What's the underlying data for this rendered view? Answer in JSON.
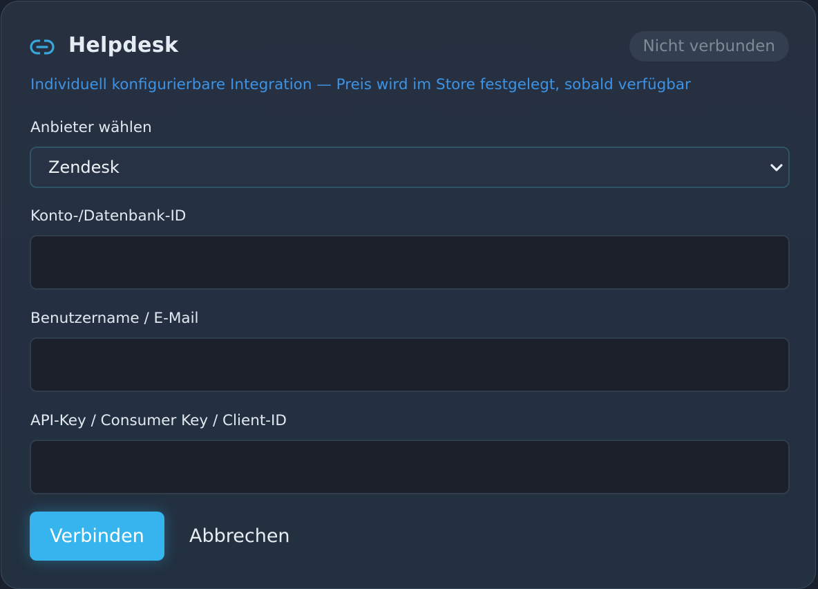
{
  "header": {
    "icon": "link-icon",
    "title": "Helpdesk",
    "status": "Nicht verbunden"
  },
  "subtitle": "Individuell konfigurierbare Integration — Preis wird im Store festgelegt, sobald verfügbar",
  "form": {
    "provider": {
      "label": "Anbieter wählen",
      "selected": "Zendesk"
    },
    "account_id": {
      "label": "Konto-/Datenbank-ID",
      "value": ""
    },
    "username": {
      "label": "Benutzername / E-Mail",
      "value": ""
    },
    "api_key": {
      "label": "API-Key / Consumer Key / Client-ID",
      "value": ""
    }
  },
  "actions": {
    "connect_label": "Verbinden",
    "cancel_label": "Abbrechen"
  },
  "colors": {
    "accent": "#36b4ee",
    "link": "#3d93e6",
    "card_bg": "#26303f",
    "input_bg": "#1b202b"
  }
}
